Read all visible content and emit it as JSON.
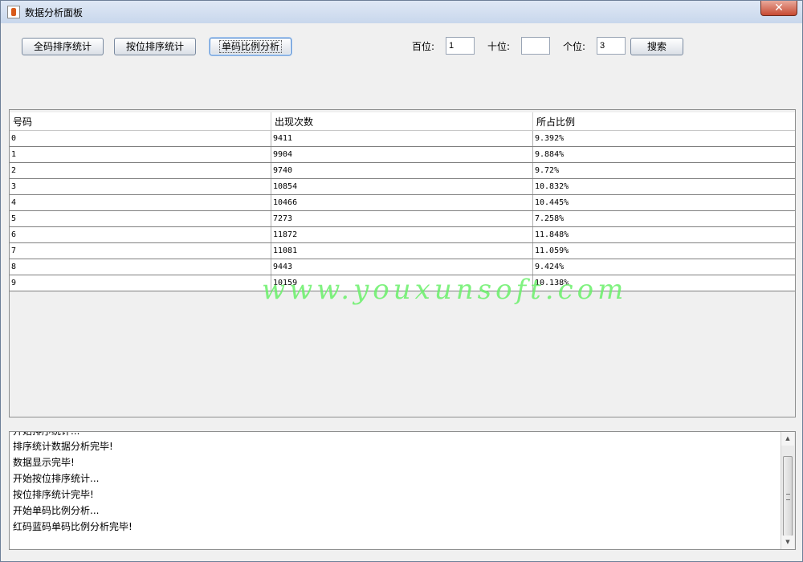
{
  "window": {
    "title": "数据分析面板",
    "close_label": "✕"
  },
  "toolbar": {
    "full_sort_label": "全码排序统计",
    "position_sort_label": "按位排序统计",
    "single_ratio_label": "单码比例分析",
    "hundreds_label": "百位:",
    "hundreds_value": "1",
    "tens_label": "十位:",
    "tens_value": "",
    "ones_label": "个位:",
    "ones_value": "3",
    "search_label": "搜索"
  },
  "table": {
    "columns": [
      "号码",
      "出现次数",
      "所占比例"
    ],
    "rows": [
      [
        "0",
        "9411",
        "9.392%"
      ],
      [
        "1",
        "9904",
        "9.884%"
      ],
      [
        "2",
        "9740",
        "9.72%"
      ],
      [
        "3",
        "10854",
        "10.832%"
      ],
      [
        "4",
        "10466",
        "10.445%"
      ],
      [
        "5",
        "7273",
        "7.258%"
      ],
      [
        "6",
        "11872",
        "11.848%"
      ],
      [
        "7",
        "11081",
        "11.059%"
      ],
      [
        "8",
        "9443",
        "9.424%"
      ],
      [
        "9",
        "10159",
        "10.138%"
      ]
    ]
  },
  "watermark": "www.youxunsoft.com",
  "log": {
    "lines": [
      "开始排序统计...",
      "排序统计数据分析完毕!",
      "数据显示完毕!",
      "开始按位排序统计...",
      "按位排序统计完毕!",
      "开始单码比例分析...",
      "红码蓝码单码比例分析完毕!"
    ]
  },
  "scrollbar": {
    "up_icon": "up-arrow-icon",
    "down_icon": "down-arrow-icon"
  }
}
